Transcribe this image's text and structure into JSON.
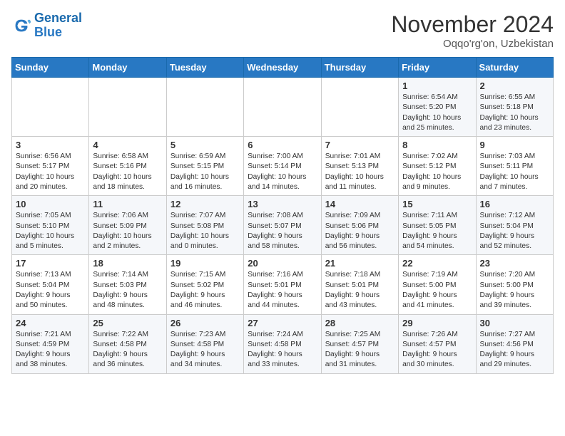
{
  "header": {
    "logo_line1": "General",
    "logo_line2": "Blue",
    "month_title": "November 2024",
    "location": "Oqqo'rg'on, Uzbekistan"
  },
  "weekdays": [
    "Sunday",
    "Monday",
    "Tuesday",
    "Wednesday",
    "Thursday",
    "Friday",
    "Saturday"
  ],
  "weeks": [
    [
      {
        "day": "",
        "info": ""
      },
      {
        "day": "",
        "info": ""
      },
      {
        "day": "",
        "info": ""
      },
      {
        "day": "",
        "info": ""
      },
      {
        "day": "",
        "info": ""
      },
      {
        "day": "1",
        "info": "Sunrise: 6:54 AM\nSunset: 5:20 PM\nDaylight: 10 hours\nand 25 minutes."
      },
      {
        "day": "2",
        "info": "Sunrise: 6:55 AM\nSunset: 5:18 PM\nDaylight: 10 hours\nand 23 minutes."
      }
    ],
    [
      {
        "day": "3",
        "info": "Sunrise: 6:56 AM\nSunset: 5:17 PM\nDaylight: 10 hours\nand 20 minutes."
      },
      {
        "day": "4",
        "info": "Sunrise: 6:58 AM\nSunset: 5:16 PM\nDaylight: 10 hours\nand 18 minutes."
      },
      {
        "day": "5",
        "info": "Sunrise: 6:59 AM\nSunset: 5:15 PM\nDaylight: 10 hours\nand 16 minutes."
      },
      {
        "day": "6",
        "info": "Sunrise: 7:00 AM\nSunset: 5:14 PM\nDaylight: 10 hours\nand 14 minutes."
      },
      {
        "day": "7",
        "info": "Sunrise: 7:01 AM\nSunset: 5:13 PM\nDaylight: 10 hours\nand 11 minutes."
      },
      {
        "day": "8",
        "info": "Sunrise: 7:02 AM\nSunset: 5:12 PM\nDaylight: 10 hours\nand 9 minutes."
      },
      {
        "day": "9",
        "info": "Sunrise: 7:03 AM\nSunset: 5:11 PM\nDaylight: 10 hours\nand 7 minutes."
      }
    ],
    [
      {
        "day": "10",
        "info": "Sunrise: 7:05 AM\nSunset: 5:10 PM\nDaylight: 10 hours\nand 5 minutes."
      },
      {
        "day": "11",
        "info": "Sunrise: 7:06 AM\nSunset: 5:09 PM\nDaylight: 10 hours\nand 2 minutes."
      },
      {
        "day": "12",
        "info": "Sunrise: 7:07 AM\nSunset: 5:08 PM\nDaylight: 10 hours\nand 0 minutes."
      },
      {
        "day": "13",
        "info": "Sunrise: 7:08 AM\nSunset: 5:07 PM\nDaylight: 9 hours\nand 58 minutes."
      },
      {
        "day": "14",
        "info": "Sunrise: 7:09 AM\nSunset: 5:06 PM\nDaylight: 9 hours\nand 56 minutes."
      },
      {
        "day": "15",
        "info": "Sunrise: 7:11 AM\nSunset: 5:05 PM\nDaylight: 9 hours\nand 54 minutes."
      },
      {
        "day": "16",
        "info": "Sunrise: 7:12 AM\nSunset: 5:04 PM\nDaylight: 9 hours\nand 52 minutes."
      }
    ],
    [
      {
        "day": "17",
        "info": "Sunrise: 7:13 AM\nSunset: 5:04 PM\nDaylight: 9 hours\nand 50 minutes."
      },
      {
        "day": "18",
        "info": "Sunrise: 7:14 AM\nSunset: 5:03 PM\nDaylight: 9 hours\nand 48 minutes."
      },
      {
        "day": "19",
        "info": "Sunrise: 7:15 AM\nSunset: 5:02 PM\nDaylight: 9 hours\nand 46 minutes."
      },
      {
        "day": "20",
        "info": "Sunrise: 7:16 AM\nSunset: 5:01 PM\nDaylight: 9 hours\nand 44 minutes."
      },
      {
        "day": "21",
        "info": "Sunrise: 7:18 AM\nSunset: 5:01 PM\nDaylight: 9 hours\nand 43 minutes."
      },
      {
        "day": "22",
        "info": "Sunrise: 7:19 AM\nSunset: 5:00 PM\nDaylight: 9 hours\nand 41 minutes."
      },
      {
        "day": "23",
        "info": "Sunrise: 7:20 AM\nSunset: 5:00 PM\nDaylight: 9 hours\nand 39 minutes."
      }
    ],
    [
      {
        "day": "24",
        "info": "Sunrise: 7:21 AM\nSunset: 4:59 PM\nDaylight: 9 hours\nand 38 minutes."
      },
      {
        "day": "25",
        "info": "Sunrise: 7:22 AM\nSunset: 4:58 PM\nDaylight: 9 hours\nand 36 minutes."
      },
      {
        "day": "26",
        "info": "Sunrise: 7:23 AM\nSunset: 4:58 PM\nDaylight: 9 hours\nand 34 minutes."
      },
      {
        "day": "27",
        "info": "Sunrise: 7:24 AM\nSunset: 4:58 PM\nDaylight: 9 hours\nand 33 minutes."
      },
      {
        "day": "28",
        "info": "Sunrise: 7:25 AM\nSunset: 4:57 PM\nDaylight: 9 hours\nand 31 minutes."
      },
      {
        "day": "29",
        "info": "Sunrise: 7:26 AM\nSunset: 4:57 PM\nDaylight: 9 hours\nand 30 minutes."
      },
      {
        "day": "30",
        "info": "Sunrise: 7:27 AM\nSunset: 4:56 PM\nDaylight: 9 hours\nand 29 minutes."
      }
    ]
  ]
}
